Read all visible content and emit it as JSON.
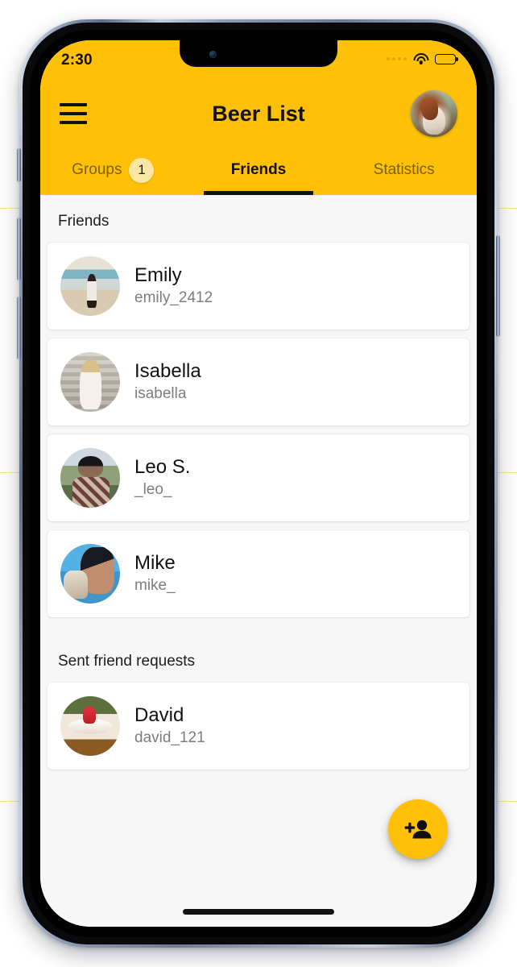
{
  "device": {
    "status_bar": {
      "time": "2:30",
      "signal_icon": "signal-dots-icon",
      "wifi_icon": "wifi-icon",
      "battery_icon": "battery-full-icon"
    },
    "home_indicator": "home-indicator"
  },
  "appbar": {
    "menu_icon": "hamburger-menu-icon",
    "title": "Beer List",
    "avatar_name": "profile-avatar"
  },
  "tabs": [
    {
      "label": "Groups",
      "badge": "1",
      "active": false
    },
    {
      "label": "Friends",
      "badge": "",
      "active": true
    },
    {
      "label": "Statistics",
      "badge": "",
      "active": false
    }
  ],
  "sections": [
    {
      "title": "Friends",
      "items": [
        {
          "name": "Emily",
          "username": "emily_2412"
        },
        {
          "name": "Isabella",
          "username": "isabella"
        },
        {
          "name": "Leo S.",
          "username": "_leo_"
        },
        {
          "name": "Mike",
          "username": "mike_"
        }
      ]
    },
    {
      "title": "Sent friend requests",
      "items": [
        {
          "name": "David",
          "username": "david_121"
        }
      ]
    }
  ],
  "fab": {
    "icon": "person-add-icon",
    "label": "Add friend"
  },
  "colors": {
    "accent": "#FFC107",
    "badge": "#FAE7A4",
    "background": "#F7F7F7",
    "card": "#FFFFFF",
    "text_primary": "#111111",
    "text_secondary": "#7D7D7D",
    "tab_inactive": "#7A6000"
  }
}
